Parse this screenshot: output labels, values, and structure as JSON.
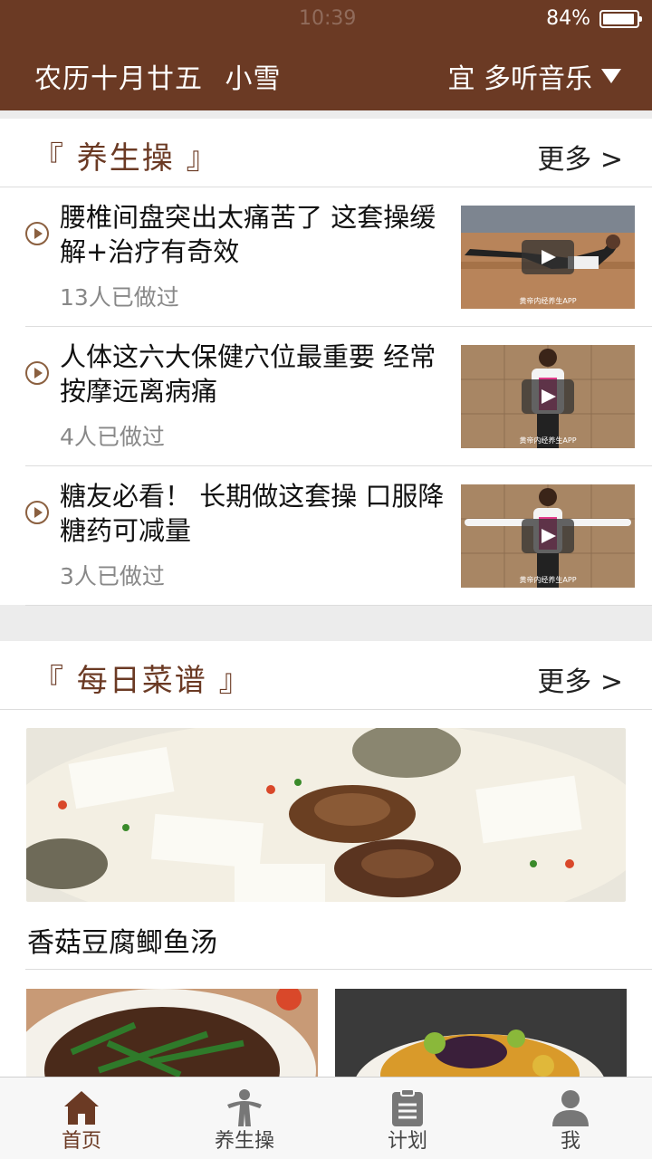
{
  "status_bar": {
    "time": "10:39",
    "battery": "84%"
  },
  "header": {
    "lunar_date": "农历十月廿五",
    "solar_term": "小雪",
    "suggestion": "宜 多听音乐"
  },
  "exercise_section": {
    "title": "『 养生操 』",
    "more": "更多 >",
    "items": [
      {
        "title": "腰椎间盘突出太痛苦了 这套操缓解+治疗有奇效",
        "count": "13人已做过",
        "watermark": "黄帝内经养生APP"
      },
      {
        "title": "人体这六大保健穴位最重要 经常按摩远离病痛",
        "count": "4人已做过",
        "watermark": "黄帝内经养生APP"
      },
      {
        "title": "糖友必看！ 长期做这套操 口服降糖药可减量",
        "count": "3人已做过",
        "watermark": "黄帝内经养生APP"
      }
    ]
  },
  "recipe_section": {
    "title": "『 每日菜谱 』",
    "more": "更多 >",
    "featured": {
      "name": "香菇豆腐鲫鱼汤"
    }
  },
  "tabbar": {
    "items": [
      {
        "label": "首页",
        "icon": "home-icon"
      },
      {
        "label": "养生操",
        "icon": "exercise-icon"
      },
      {
        "label": "计划",
        "icon": "clipboard-icon"
      },
      {
        "label": "我",
        "icon": "user-icon"
      }
    ]
  },
  "colors": {
    "brand": "#6b3a24",
    "accent_icon": "#8b6040",
    "background": "#ececec"
  }
}
